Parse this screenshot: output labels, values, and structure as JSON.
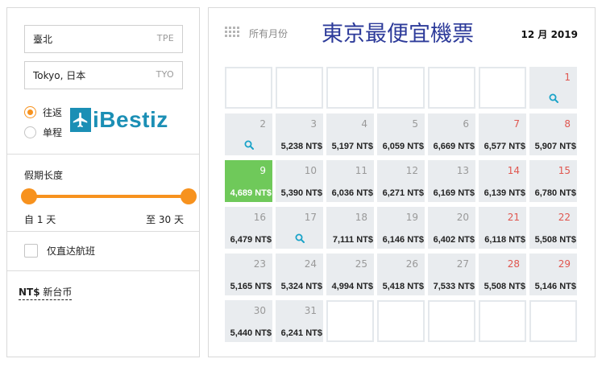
{
  "origin": {
    "value": "臺北",
    "code": "TPE"
  },
  "destination": {
    "value": "Tokyo, 日本",
    "code": "TYO"
  },
  "trip_type": {
    "options": [
      "往返",
      "单程"
    ],
    "selected": "往返"
  },
  "logo": {
    "text": "iBestiz",
    "color": "#1b8fb5"
  },
  "duration": {
    "title": "假期长度",
    "min_label": "自 1 天",
    "max_label": "至 30 天",
    "min": 1,
    "max": 30
  },
  "direct_only": {
    "label": "仅直达航班",
    "checked": false
  },
  "currency": {
    "code": "NT$",
    "name": "新台币"
  },
  "calendar": {
    "all_months_label": "所有月份",
    "title": "東京最便宜機票",
    "month_label": "12 月 2019",
    "accent": "#f7921e",
    "best_color": "#6fc95a",
    "weekend_color": "#e0564f",
    "leading_blanks": 6,
    "trailing_blanks": 5,
    "days": [
      {
        "day": "1",
        "price": "",
        "weekend": true,
        "search": true
      },
      {
        "day": "2",
        "price": "",
        "weekend": false,
        "search": true
      },
      {
        "day": "3",
        "price": "5,238 NT$",
        "weekend": false
      },
      {
        "day": "4",
        "price": "5,197 NT$",
        "weekend": false
      },
      {
        "day": "5",
        "price": "6,059 NT$",
        "weekend": false
      },
      {
        "day": "6",
        "price": "6,669 NT$",
        "weekend": false
      },
      {
        "day": "7",
        "price": "6,577 NT$",
        "weekend": true
      },
      {
        "day": "8",
        "price": "5,907 NT$",
        "weekend": true
      },
      {
        "day": "9",
        "price": "4,689 NT$",
        "weekend": false,
        "best": true
      },
      {
        "day": "10",
        "price": "5,390 NT$",
        "weekend": false
      },
      {
        "day": "11",
        "price": "6,036 NT$",
        "weekend": false
      },
      {
        "day": "12",
        "price": "6,271 NT$",
        "weekend": false
      },
      {
        "day": "13",
        "price": "6,169 NT$",
        "weekend": false
      },
      {
        "day": "14",
        "price": "6,139 NT$",
        "weekend": true
      },
      {
        "day": "15",
        "price": "6,780 NT$",
        "weekend": true
      },
      {
        "day": "16",
        "price": "6,479 NT$",
        "weekend": false
      },
      {
        "day": "17",
        "price": "",
        "weekend": false,
        "search": true
      },
      {
        "day": "18",
        "price": "7,111 NT$",
        "weekend": false
      },
      {
        "day": "19",
        "price": "6,146 NT$",
        "weekend": false
      },
      {
        "day": "20",
        "price": "6,402 NT$",
        "weekend": false
      },
      {
        "day": "21",
        "price": "6,118 NT$",
        "weekend": true
      },
      {
        "day": "22",
        "price": "5,508 NT$",
        "weekend": true
      },
      {
        "day": "23",
        "price": "5,165 NT$",
        "weekend": false
      },
      {
        "day": "24",
        "price": "5,324 NT$",
        "weekend": false
      },
      {
        "day": "25",
        "price": "4,994 NT$",
        "weekend": false
      },
      {
        "day": "26",
        "price": "5,418 NT$",
        "weekend": false
      },
      {
        "day": "27",
        "price": "7,533 NT$",
        "weekend": false
      },
      {
        "day": "28",
        "price": "5,508 NT$",
        "weekend": true
      },
      {
        "day": "29",
        "price": "5,146 NT$",
        "weekend": true
      },
      {
        "day": "30",
        "price": "5,440 NT$",
        "weekend": false
      },
      {
        "day": "31",
        "price": "6,241 NT$",
        "weekend": false
      }
    ]
  }
}
